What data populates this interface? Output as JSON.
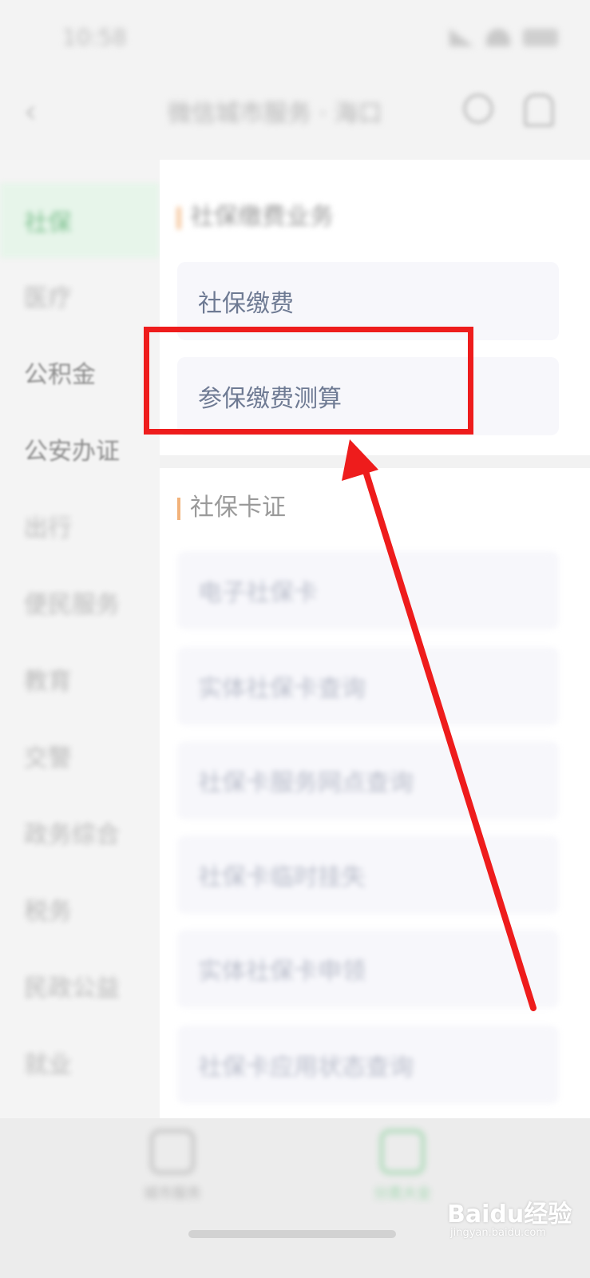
{
  "status_bar": {
    "time": "10:58"
  },
  "nav": {
    "title": "微信城市服务 · 海口"
  },
  "sidebar": {
    "items": [
      {
        "label": "社保"
      },
      {
        "label": "医疗"
      },
      {
        "label": "公积金"
      },
      {
        "label": "公安办证"
      },
      {
        "label": "出行"
      },
      {
        "label": "便民服务"
      },
      {
        "label": "教育"
      },
      {
        "label": "交警"
      },
      {
        "label": "政务综合"
      },
      {
        "label": "税务"
      },
      {
        "label": "民政公益"
      },
      {
        "label": "就业"
      }
    ]
  },
  "main": {
    "section1": {
      "title": "社保缴费业务",
      "cards": [
        {
          "label": "社保缴费"
        },
        {
          "label": "参保缴费测算"
        }
      ]
    },
    "section2": {
      "title": "社保卡证",
      "cards": [
        {
          "label": "电子社保卡"
        },
        {
          "label": "实体社保卡查询"
        },
        {
          "label": "社保卡服务网点查询"
        },
        {
          "label": "社保卡临时挂失"
        },
        {
          "label": "实体社保卡申领"
        },
        {
          "label": "社保卡应用状态查询"
        }
      ]
    }
  },
  "tabbar": {
    "tab1": "城市服务",
    "tab2": "分类大全"
  },
  "watermark": {
    "text": "Baidu经验",
    "sub": "jingyan.baidu.com"
  },
  "colors": {
    "annotation": "#ee1c1c",
    "accent_green": "#7cc08e",
    "section_bar": "#f2b27a"
  }
}
